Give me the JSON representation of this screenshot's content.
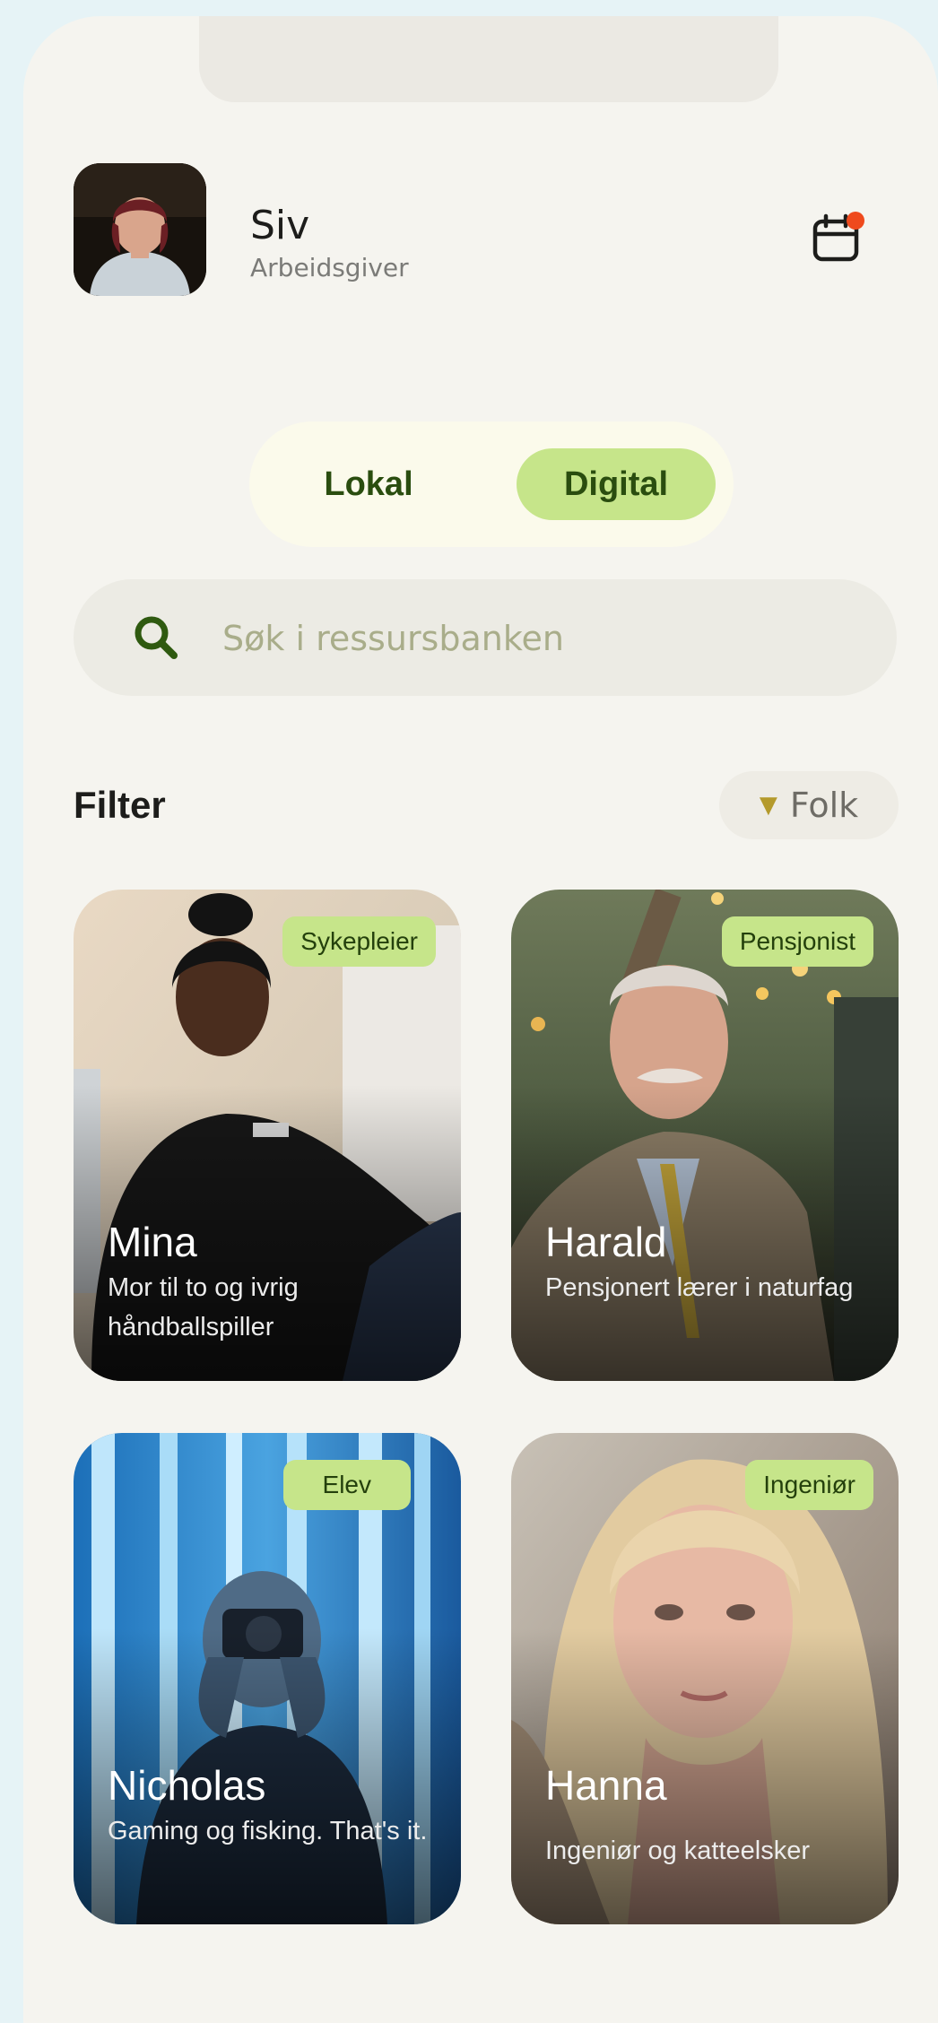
{
  "user": {
    "name": "Siv",
    "role": "Arbeidsgiver"
  },
  "header": {
    "calendar_icon": "calendar-icon",
    "has_notification": true
  },
  "mode_toggle": {
    "options": [
      "Lokal",
      "Digital"
    ],
    "selected": "Digital"
  },
  "search": {
    "placeholder": "Søk i ressursbanken",
    "value": ""
  },
  "filter": {
    "label": "Filter",
    "selected": "Folk"
  },
  "colors": {
    "accent": "#c6e58a",
    "accent_text": "#2a4d0f",
    "notification": "#ef4a1d",
    "background": "#f5f4ef"
  },
  "people": [
    {
      "name": "Mina",
      "tag": "Sykepleier",
      "description": "Mor til to og ivrig håndballspiller"
    },
    {
      "name": "Harald",
      "tag": "Pensjonist",
      "description": "Pensjonert lærer i naturfag"
    },
    {
      "name": "Nicholas",
      "tag": "Elev",
      "description": "Gaming og fisking. That's it."
    },
    {
      "name": "Hanna",
      "tag": "Ingeniør",
      "description": "Ingeniør og katteelsker"
    }
  ]
}
